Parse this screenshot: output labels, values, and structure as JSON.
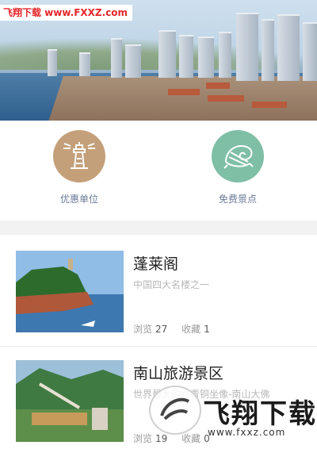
{
  "watermark": {
    "top_text": "飞翔下载 www.FXXZ.com",
    "logo_text": "飞翔下载",
    "logo_url": "www.fxxz.com"
  },
  "categories": [
    {
      "label": "优惠单位",
      "icon": "lighthouse-icon",
      "color": "#c4a07a"
    },
    {
      "label": "免费景点",
      "icon": "shell-icon",
      "color": "#7fbfa6"
    }
  ],
  "attractions": [
    {
      "title": "蓬莱阁",
      "subtitle": "中国四大名楼之一",
      "views_label": "浏览",
      "views": "27",
      "favorites_label": "收藏",
      "favorites": "1"
    },
    {
      "title": "南山旅游景区",
      "subtitle": "世界最大的锡青铜坐像-南山大佛",
      "views_label": "浏览",
      "views": "19",
      "favorites_label": "收藏",
      "favorites": "0"
    }
  ]
}
